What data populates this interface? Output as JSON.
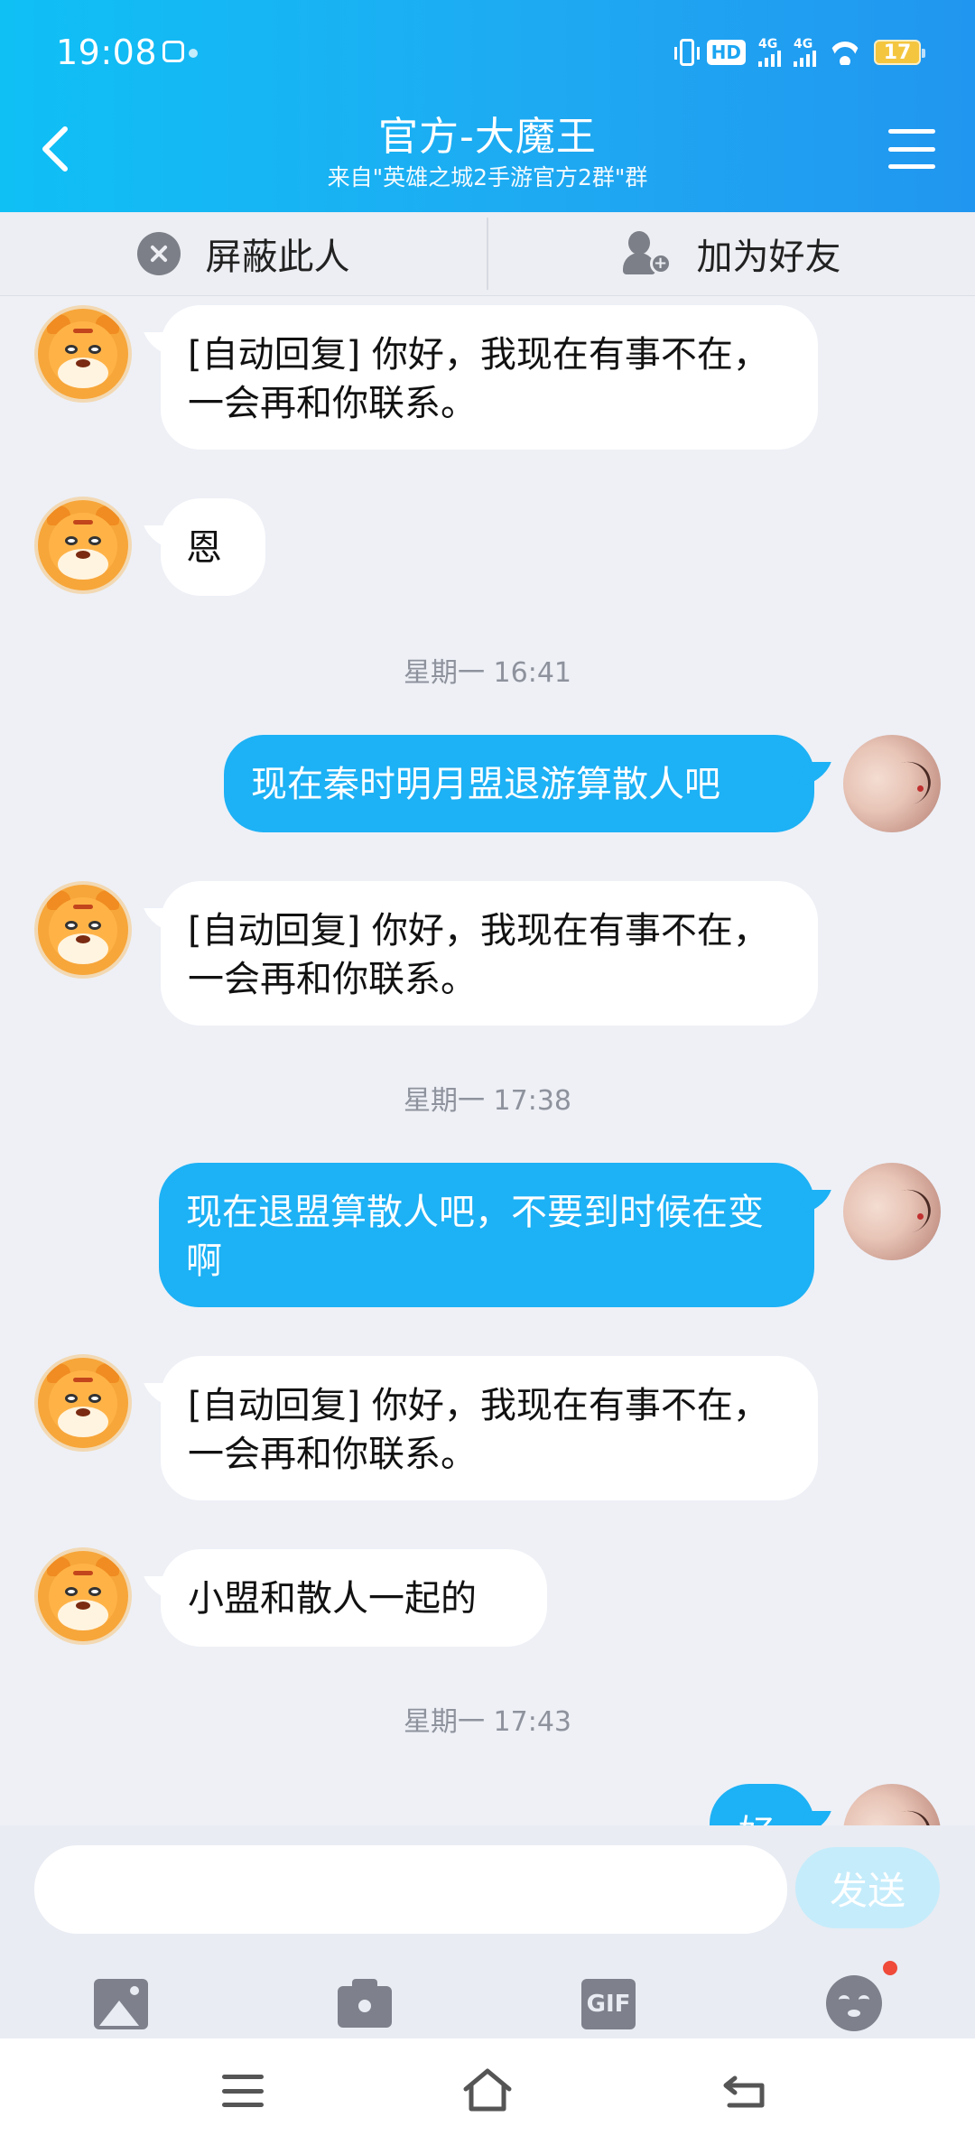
{
  "status_bar": {
    "time": "19:08",
    "hd_label": "HD",
    "signal1_label": "4G",
    "signal2_label": "4G",
    "battery": "17"
  },
  "header": {
    "title": "官方-大魔王",
    "subtitle": "来自\"英雄之城2手游官方2群\"群"
  },
  "actions": {
    "block_label": "屏蔽此人",
    "add_friend_label": "加为好友"
  },
  "messages": [
    {
      "side": "in",
      "text": "[自动回复] 你好，我现在有事不在，一会再和你联系。"
    },
    {
      "side": "in",
      "text": "恩"
    },
    {
      "timestamp": "星期一 16:41"
    },
    {
      "side": "out",
      "text": "现在秦时明月盟退游算散人吧"
    },
    {
      "side": "in",
      "text": "[自动回复] 你好，我现在有事不在，一会再和你联系。"
    },
    {
      "timestamp": "星期一 17:38"
    },
    {
      "side": "out",
      "text": "现在退盟算散人吧，不要到时候在变啊"
    },
    {
      "side": "in",
      "text": "[自动回复] 你好，我现在有事不在，一会再和你联系。"
    },
    {
      "side": "in",
      "text": "小盟和散人一起的"
    },
    {
      "timestamp": "星期一 17:43"
    },
    {
      "side": "out",
      "text": "好"
    }
  ],
  "input": {
    "placeholder": "",
    "send_label": "发送",
    "gif_label": "GIF"
  },
  "icons": [
    "back-icon",
    "menu-icon",
    "block-icon",
    "add-friend-icon",
    "image-icon",
    "camera-icon",
    "gif-icon",
    "emoji-icon",
    "nav-menu-icon",
    "nav-home-icon",
    "nav-back-icon"
  ],
  "colors": {
    "header_gradient_start": "#0fc0f5",
    "header_gradient_end": "#2196f0",
    "outgoing_bubble": "#1db1f5",
    "incoming_bubble": "#ffffff",
    "send_button": "#c5ecfb",
    "badge_dot": "#f04a3a"
  }
}
